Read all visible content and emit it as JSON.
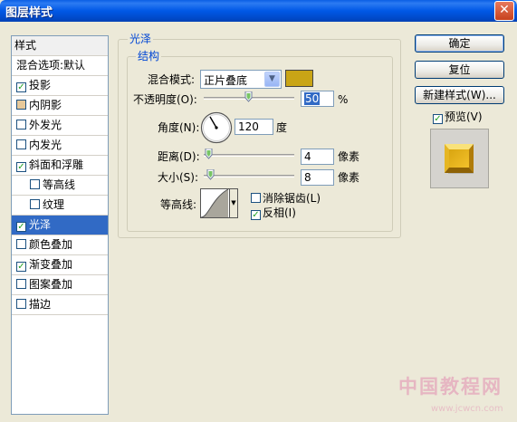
{
  "window": {
    "title": "图层样式",
    "close_glyph": "✕"
  },
  "style_list": {
    "header": "样式",
    "blend_options": "混合选项:默认",
    "items": [
      {
        "label": "投影",
        "checked": true
      },
      {
        "label": "内阴影",
        "checked": false
      },
      {
        "label": "外发光",
        "checked": false
      },
      {
        "label": "内发光",
        "checked": false
      },
      {
        "label": "斜面和浮雕",
        "checked": true
      },
      {
        "label": "等高线",
        "checked": false
      },
      {
        "label": "纹理",
        "checked": false
      },
      {
        "label": "光泽",
        "checked": true
      },
      {
        "label": "颜色叠加",
        "checked": false
      },
      {
        "label": "渐变叠加",
        "checked": true
      },
      {
        "label": "图案叠加",
        "checked": false
      },
      {
        "label": "描边",
        "checked": false
      }
    ]
  },
  "satin": {
    "group_title": "光泽",
    "structure_title": "结构",
    "blend_mode_label": "混合模式:",
    "blend_mode_value": "正片叠底",
    "blend_color": "#C9A516",
    "opacity_label": "不透明度(O):",
    "opacity_value": "50",
    "opacity_unit": "%",
    "angle_label": "角度(N):",
    "angle_value": "120",
    "angle_unit": "度",
    "distance_label": "距离(D):",
    "distance_value": "4",
    "distance_unit": "像素",
    "size_label": "大小(S):",
    "size_value": "8",
    "size_unit": "像素",
    "contour_label": "等高线:",
    "antialias_label": "消除锯齿(L)",
    "antialias_checked": false,
    "invert_label": "反相(I)",
    "invert_checked": true
  },
  "buttons": {
    "ok": "确定",
    "reset": "复位",
    "new_style": "新建样式(W)...",
    "preview_label": "预览(V)",
    "preview_checked": true
  },
  "watermark": {
    "text": "中国教程网",
    "url": "www.jcwcn.com"
  }
}
